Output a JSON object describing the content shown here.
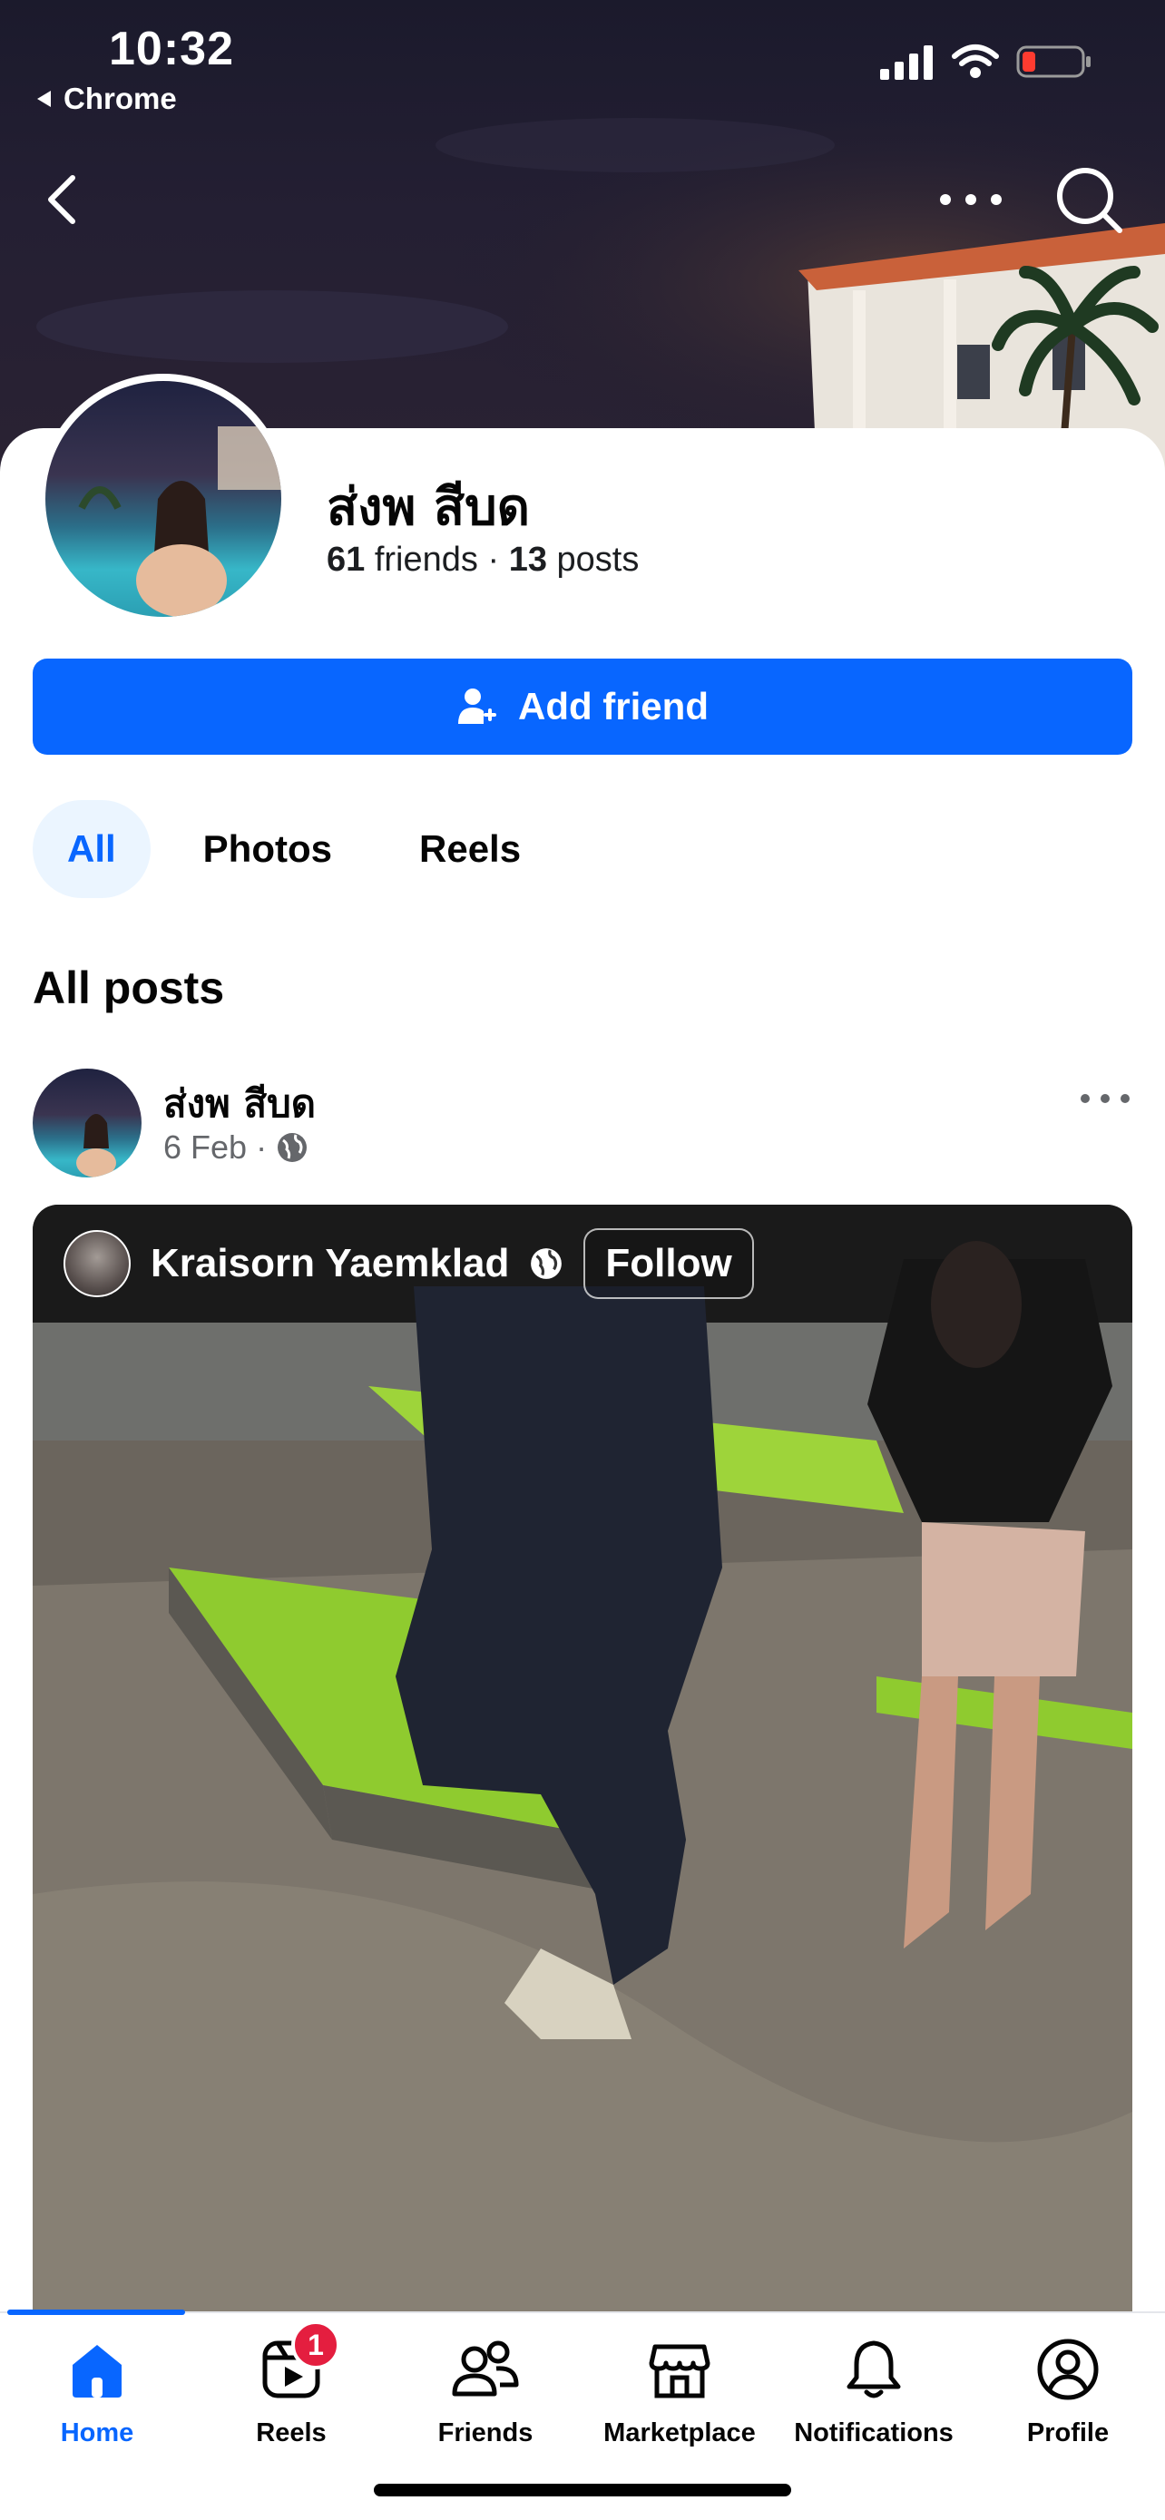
{
  "status_bar": {
    "time": "10:32",
    "back_app": "Chrome"
  },
  "profile": {
    "name": "ส่งพ สีบด",
    "friends_count": "61",
    "friends_label": "friends",
    "separator": "·",
    "posts_count": "13",
    "posts_label": "posts"
  },
  "add_friend_label": "Add friend",
  "tabs": [
    {
      "label": "All",
      "active": true
    },
    {
      "label": "Photos",
      "active": false
    },
    {
      "label": "Reels",
      "active": false
    }
  ],
  "section_title": "All posts",
  "post": {
    "author": "ส่งพ สีบด",
    "date": "6 Feb",
    "separator": "·",
    "video": {
      "creator": "Kraisorn Yaemklad",
      "follow_label": "Follow"
    }
  },
  "tabbar": [
    {
      "label": "Home",
      "icon": "home-icon",
      "active": true
    },
    {
      "label": "Reels",
      "icon": "reels-icon",
      "badge": "1"
    },
    {
      "label": "Friends",
      "icon": "friends-icon"
    },
    {
      "label": "Marketplace",
      "icon": "marketplace-icon"
    },
    {
      "label": "Notifications",
      "icon": "bell-icon"
    },
    {
      "label": "Profile",
      "icon": "profile-icon"
    }
  ],
  "colors": {
    "accent": "#0866ff",
    "badge": "#e41e3f",
    "tab_active_bg": "#ebf5ff"
  }
}
